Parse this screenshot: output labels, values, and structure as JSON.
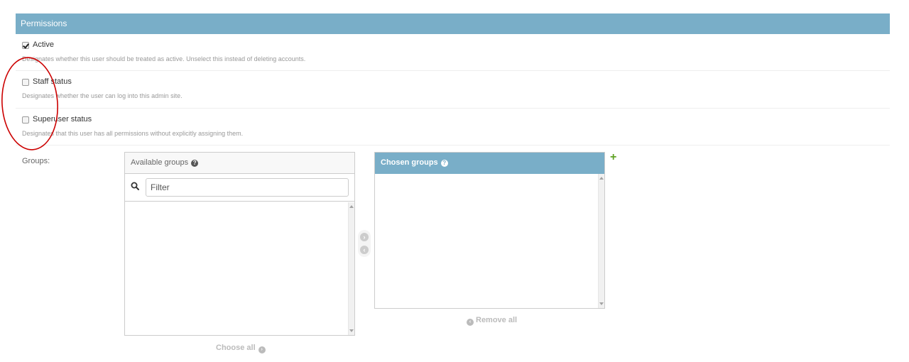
{
  "fieldset": {
    "title": "Permissions"
  },
  "active": {
    "label": "Active",
    "checked": true,
    "help": "Designates whether this user should be treated as active. Unselect this instead of deleting accounts."
  },
  "staff": {
    "label": "Staff status",
    "checked": false,
    "help": "Designates whether the user can log into this admin site."
  },
  "superuser": {
    "label": "Superuser status",
    "checked": false,
    "help": "Designates that this user has all permissions without explicitly assigning them."
  },
  "groups": {
    "label": "Groups:",
    "available_title": "Available groups",
    "chosen_title": "Chosen groups",
    "filter_placeholder": "Filter",
    "choose_all": "Choose all",
    "remove_all": "Remove all",
    "available_items": [],
    "chosen_items": []
  },
  "icons": {
    "help": "question-circle-icon",
    "search": "search-icon",
    "add": "plus-icon",
    "choose_arrow": "arrow-right-circle-icon",
    "remove_arrow": "arrow-left-circle-icon"
  },
  "colors": {
    "header": "#79aec8",
    "add": "#5fa225",
    "annotation": "#cc0000",
    "disabled": "#bbbbbb"
  }
}
